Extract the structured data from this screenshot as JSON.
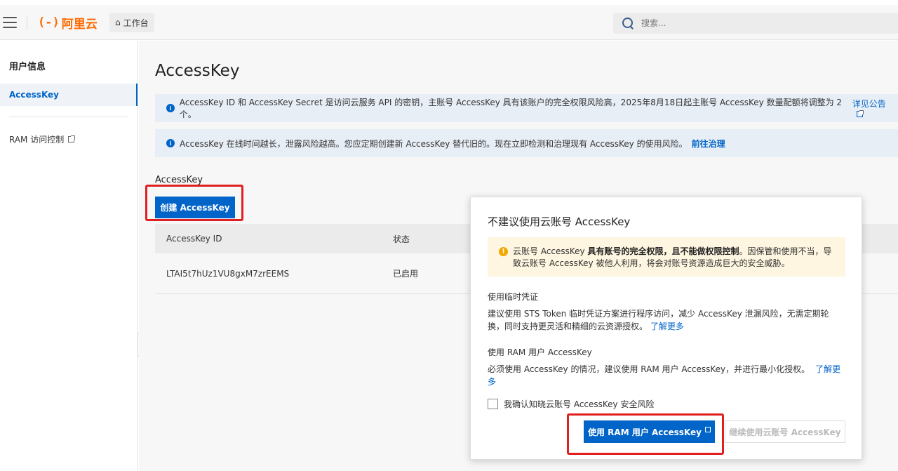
{
  "header": {
    "logo_text": "阿里云",
    "logo_mark": "(-)",
    "workbench_label": "工作台",
    "search_placeholder": "搜索..."
  },
  "sidebar": {
    "title": "用户信息",
    "items": [
      {
        "label": "AccessKey",
        "active": true
      },
      {
        "label": "RAM 访问控制",
        "external": true
      }
    ]
  },
  "main": {
    "page_title": "AccessKey",
    "notices": [
      {
        "text": "AccessKey ID 和 AccessKey Secret 是访问云服务 API 的密钥，主账号 AccessKey 具有该账户的完全权限风险高，2025年8月18日起主账号 AccessKey 数量配额将调整为 2 个。",
        "link": "详见公告"
      },
      {
        "text": "AccessKey 在线时间越长，泄露风险越高。您应定期创建新 AccessKey 替代旧的。现在立即检测和治理现有 AccessKey 的使用风险。",
        "link": "前往治理"
      }
    ],
    "section_label": "AccessKey",
    "create_button": "创建 AccessKey",
    "table": {
      "headers": [
        "AccessKey ID",
        "状态"
      ],
      "rows": [
        {
          "id": "LTAI5t7hUz1VU8gxM7zrEEMS",
          "status": "已启用"
        }
      ]
    }
  },
  "dialog": {
    "title": "不建议使用云账号 AccessKey",
    "warning_pre": "云账号 AccessKey ",
    "warning_bold": "具有账号的完全权限，且不能做权限控制",
    "warning_post": "。因保管和使用不当，导致云账号 AccessKey 被他人利用，将会对账号资源造成巨大的安全威胁。",
    "sections": [
      {
        "heading": "使用临时凭证",
        "body": "建议使用 STS Token 临时凭证方案进行程序访问，减少 AccessKey 泄漏风险，无需定期轮换，同时支持更灵活和精细的云资源授权。",
        "link": "了解更多"
      },
      {
        "heading": "使用 RAM 用户 AccessKey",
        "body": "必须使用 AccessKey 的情况，建议使用 RAM 用户 AccessKey，并进行最小化授权。",
        "link": "了解更多"
      }
    ],
    "checkbox_label": "我确认知晓云账号 AccessKey 安全风险",
    "primary_button": "使用 RAM 用户 AccessKey",
    "secondary_button": "继续使用云账号 AccessKey"
  },
  "colors": {
    "brand": "#ff6a00",
    "primary": "#0064c8",
    "highlight": "#e02020",
    "warning_bg": "#fef6e0"
  }
}
